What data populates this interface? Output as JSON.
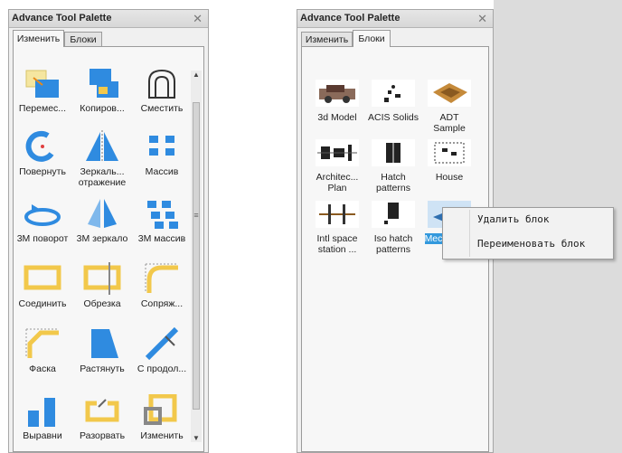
{
  "palette_left": {
    "title": "Advance Tool Palette",
    "close": "✕",
    "tabs": [
      "Изменить",
      "Блоки"
    ],
    "active_tab": "Изменить",
    "tools": [
      {
        "label": "Перемес...",
        "icon": "move-icon"
      },
      {
        "label": "Копиров...",
        "icon": "copy-icon"
      },
      {
        "label": "Сместить",
        "icon": "offset-icon"
      },
      {
        "label": "Повернуть",
        "icon": "rotate-icon"
      },
      {
        "label": "Зеркаль... отражение",
        "icon": "mirror-icon"
      },
      {
        "label": "Массив",
        "icon": "array-icon"
      },
      {
        "label": "3M поворот",
        "icon": "3d-rotate-icon"
      },
      {
        "label": "3M зеркало",
        "icon": "3d-mirror-icon"
      },
      {
        "label": "3M массив",
        "icon": "3d-array-icon"
      },
      {
        "label": "Соединить",
        "icon": "join-icon"
      },
      {
        "label": "Обрезка",
        "icon": "trim-icon"
      },
      {
        "label": "Сопряж...",
        "icon": "fillet-icon"
      },
      {
        "label": "Фаска",
        "icon": "chamfer-icon"
      },
      {
        "label": "Растянуть",
        "icon": "stretch-icon"
      },
      {
        "label": "С продол...",
        "icon": "lengthen-icon"
      },
      {
        "label": "Выравни",
        "icon": "align-icon"
      },
      {
        "label": "Разорвать",
        "icon": "break-icon"
      },
      {
        "label": "Изменить",
        "icon": "scale-icon"
      }
    ]
  },
  "palette_right": {
    "title": "Advance Tool Palette",
    "close": "✕",
    "tabs": [
      "Изменить",
      "Блоки"
    ],
    "active_tab": "Блоки",
    "blocks": [
      {
        "label": "3d Model",
        "icon": "3d-model-thumbnail"
      },
      {
        "label": "ACIS Solids",
        "icon": "acis-solids-thumbnail"
      },
      {
        "label": "ADT Sample",
        "icon": "adt-sample-thumbnail"
      },
      {
        "label": "Architec... Plan",
        "icon": "architectural-plan-thumbnail"
      },
      {
        "label": "Hatch patterns",
        "icon": "hatch-patterns-thumbnail"
      },
      {
        "label": "House",
        "icon": "house-thumbnail"
      },
      {
        "label": "Intl space station ...",
        "icon": "space-station-thumbnail"
      },
      {
        "label": "Iso hatch patterns",
        "icon": "iso-hatch-thumbnail"
      },
      {
        "label": "Mech Piece",
        "icon": "mech-piece-thumbnail"
      }
    ]
  },
  "context_menu": {
    "items": [
      "Удалить блок",
      "Переименовать блок"
    ]
  },
  "colors": {
    "selection": "#3399dd",
    "icon_blue": "#2f8be0",
    "icon_yellow": "#f2c84b"
  }
}
